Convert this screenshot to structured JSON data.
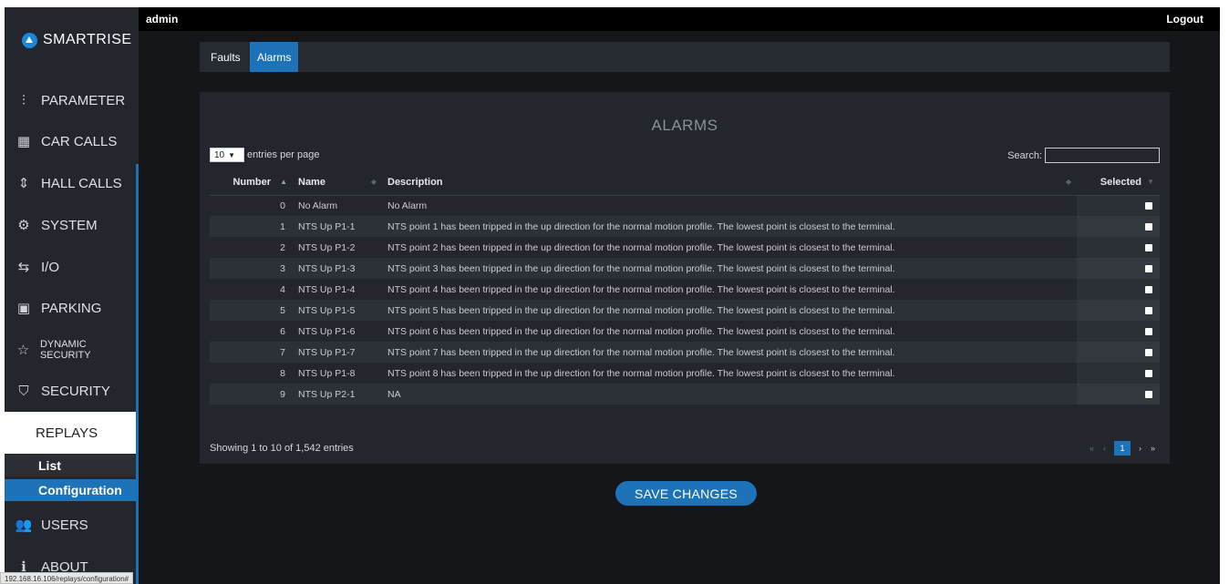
{
  "brand": {
    "name": "SMARTRISE"
  },
  "topbar": {
    "user": "admin",
    "logout": "Logout"
  },
  "sidebar": {
    "items": [
      {
        "label": "PARAMETER",
        "icon": "sliders-icon"
      },
      {
        "label": "CAR CALLS",
        "icon": "car-calls-icon"
      },
      {
        "label": "HALL CALLS",
        "icon": "hall-calls-icon"
      },
      {
        "label": "SYSTEM",
        "icon": "gear-icon"
      },
      {
        "label": "I/O",
        "icon": "io-arrows-icon"
      },
      {
        "label": "PARKING",
        "icon": "parking-icon"
      },
      {
        "label": "DYNAMIC SECURITY",
        "icon": "star-icon"
      },
      {
        "label": "SECURITY",
        "icon": "shield-icon"
      },
      {
        "label": "REPLAYS"
      },
      {
        "label": "USERS",
        "icon": "users-icon"
      },
      {
        "label": "ABOUT",
        "icon": "info-icon"
      }
    ],
    "replays_sub": [
      "List",
      "Configuration"
    ]
  },
  "tabs": [
    "Faults",
    "Alarms"
  ],
  "active_tab": "Alarms",
  "panel": {
    "title": "ALARMS",
    "entries_value": "10",
    "entries_label": "entries per page",
    "search_label": "Search:",
    "search_value": "",
    "columns": [
      "Number",
      "Name",
      "Description",
      "Selected"
    ],
    "rows": [
      {
        "number": "0",
        "name": "No Alarm",
        "description": "No Alarm",
        "selected": true
      },
      {
        "number": "1",
        "name": "NTS Up P1-1",
        "description": "NTS point 1 has been tripped in the up direction for the normal motion profile. The lowest point is closest to the terminal.",
        "selected": true
      },
      {
        "number": "2",
        "name": "NTS Up P1-2",
        "description": "NTS point 2 has been tripped in the up direction for the normal motion profile. The lowest point is closest to the terminal.",
        "selected": true
      },
      {
        "number": "3",
        "name": "NTS Up P1-3",
        "description": "NTS point 3 has been tripped in the up direction for the normal motion profile. The lowest point is closest to the terminal.",
        "selected": true
      },
      {
        "number": "4",
        "name": "NTS Up P1-4",
        "description": "NTS point 4 has been tripped in the up direction for the normal motion profile. The lowest point is closest to the terminal.",
        "selected": true
      },
      {
        "number": "5",
        "name": "NTS Up P1-5",
        "description": "NTS point 5 has been tripped in the up direction for the normal motion profile. The lowest point is closest to the terminal.",
        "selected": true
      },
      {
        "number": "6",
        "name": "NTS Up P1-6",
        "description": "NTS point 6 has been tripped in the up direction for the normal motion profile. The lowest point is closest to the terminal.",
        "selected": true
      },
      {
        "number": "7",
        "name": "NTS Up P1-7",
        "description": "NTS point 7 has been tripped in the up direction for the normal motion profile. The lowest point is closest to the terminal.",
        "selected": true
      },
      {
        "number": "8",
        "name": "NTS Up P1-8",
        "description": "NTS point 8 has been tripped in the up direction for the normal motion profile. The lowest point is closest to the terminal.",
        "selected": true
      },
      {
        "number": "9",
        "name": "NTS Up P2-1",
        "description": "NA",
        "selected": true
      }
    ],
    "info": "Showing 1 to 10 of 1,542 entries",
    "pager": {
      "first": "«",
      "prev": "‹",
      "current": "1",
      "next": "›",
      "last": "»"
    }
  },
  "save_label": "SAVE CHANGES",
  "status_url": "192.168.16.106/replays/configuration#",
  "colors": {
    "accent": "#1e72b8",
    "logo": "#1a87d8",
    "background": "#14161a"
  }
}
